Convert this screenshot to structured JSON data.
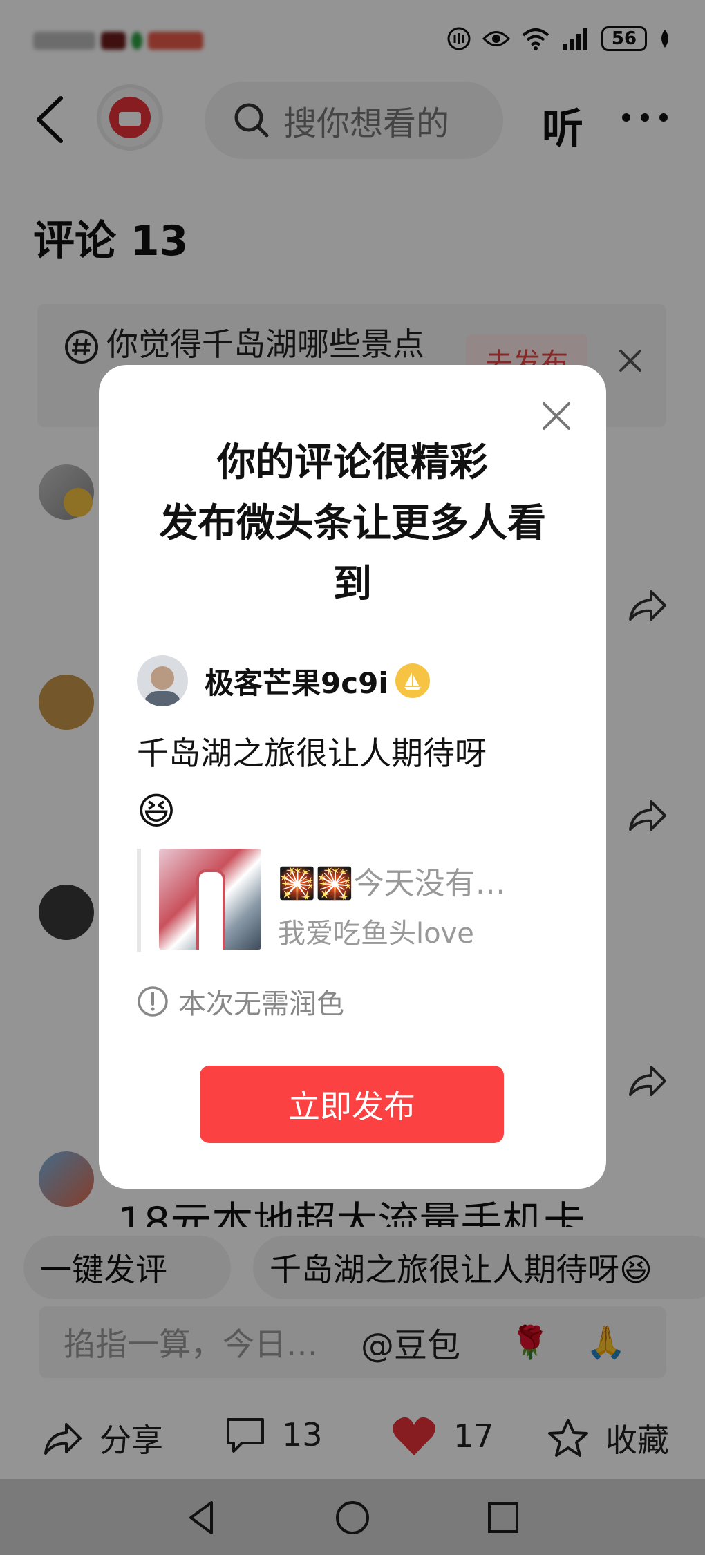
{
  "status_bar": {
    "battery": "56"
  },
  "header": {
    "search_placeholder": "搜你想看的",
    "listen_label": "听"
  },
  "comments": {
    "title": "评论 13",
    "topic_text": "你觉得千岛湖哪些景点",
    "topic_button": "去发布",
    "partial_comment": "18元本地超大流量手机卡"
  },
  "quick_reply": {
    "one_click": "一键发评",
    "suggestion": "千岛湖之旅很让人期待呀😆"
  },
  "input_bar": {
    "placeholder": "掐指一算，今日…",
    "mention": "@豆包",
    "emoji_1": "🌹",
    "emoji_2": "🙏"
  },
  "bottom_bar": {
    "share_label": "分享",
    "comment_count": "13",
    "like_count": "17",
    "favorite_label": "收藏"
  },
  "dialog": {
    "title_line1": "你的评论很精彩",
    "title_line2": "发布微头条让更多人看",
    "title_line3": "到",
    "username": "极客芒果9c9i",
    "comment_text": "千岛湖之旅很让人期待呀",
    "comment_emoji": "😆",
    "quote_title": "🎇🎇今天没有…",
    "quote_author": "我爱吃鱼头love",
    "hint": "本次无需润色",
    "publish_button": "立即发布"
  },
  "colors": {
    "accent_red": "#fb4141",
    "heart_red": "#e8313a",
    "badge_gold": "#f6c342"
  }
}
